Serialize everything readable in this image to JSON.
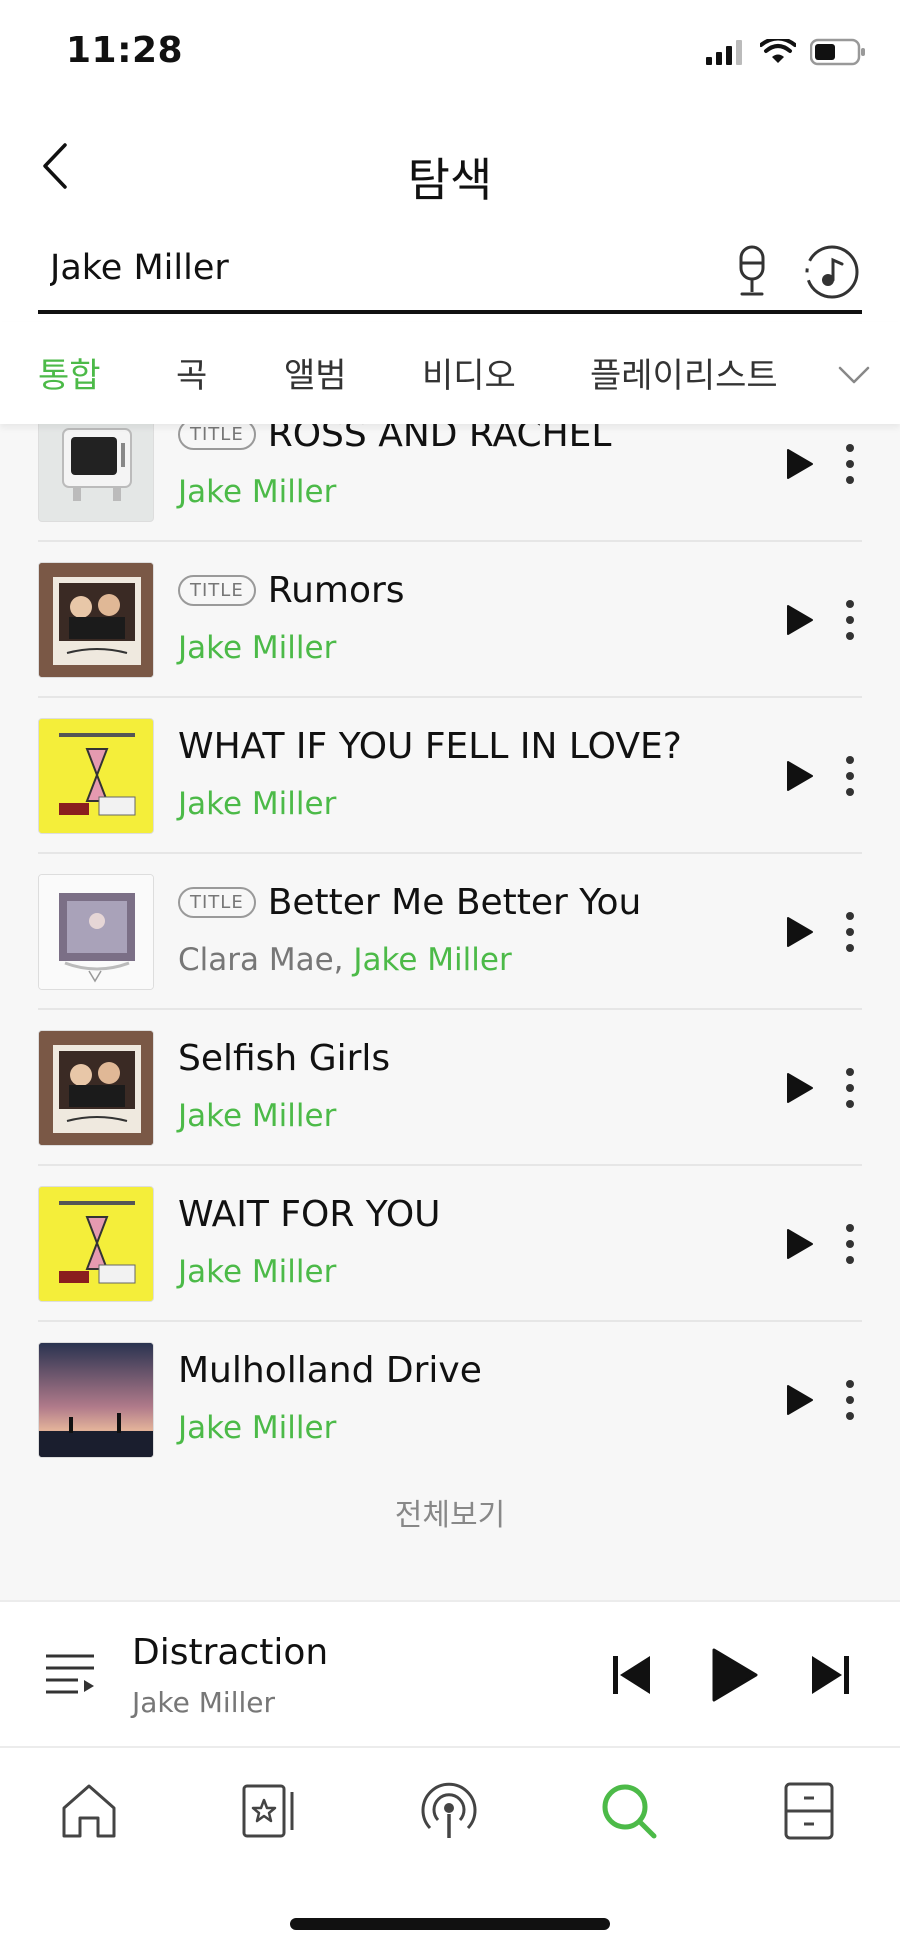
{
  "status_bar": {
    "time": "11:28"
  },
  "header": {
    "title": "탐색"
  },
  "search": {
    "value": "Jake Miller"
  },
  "tabs": [
    {
      "label": "통합",
      "active": true
    },
    {
      "label": "곡",
      "active": false
    },
    {
      "label": "앨범",
      "active": false
    },
    {
      "label": "비디오",
      "active": false
    },
    {
      "label": "플레이리스트",
      "active": false
    }
  ],
  "songs": [
    {
      "title": "ROSS AND RACHEL",
      "badge": "TITLE",
      "artists_gray": "",
      "artists_green": "Jake Miller"
    },
    {
      "title": "Rumors",
      "badge": "TITLE",
      "artists_gray": "",
      "artists_green": "Jake Miller"
    },
    {
      "title": "WHAT IF YOU FELL IN LOVE?",
      "badge": "",
      "artists_gray": "",
      "artists_green": "Jake Miller"
    },
    {
      "title": "Better Me Better You",
      "badge": "TITLE",
      "artists_gray": "Clara Mae, ",
      "artists_green": "Jake Miller"
    },
    {
      "title": "Selfish Girls",
      "badge": "",
      "artists_gray": "",
      "artists_green": "Jake Miller"
    },
    {
      "title": "WAIT FOR YOU",
      "badge": "",
      "artists_gray": "",
      "artists_green": "Jake Miller"
    },
    {
      "title": "Mulholland Drive",
      "badge": "",
      "artists_gray": "",
      "artists_green": "Jake Miller"
    }
  ],
  "view_all": "전체보기",
  "mini_player": {
    "title": "Distraction",
    "artist": "Jake Miller"
  },
  "colors": {
    "accent": "#4cba48",
    "text": "#111111",
    "secondary": "#777777"
  },
  "icons": {
    "nav": [
      "home-icon",
      "library-icon",
      "podcast-icon",
      "search-icon",
      "storage-icon"
    ],
    "active_nav": "search-icon"
  }
}
